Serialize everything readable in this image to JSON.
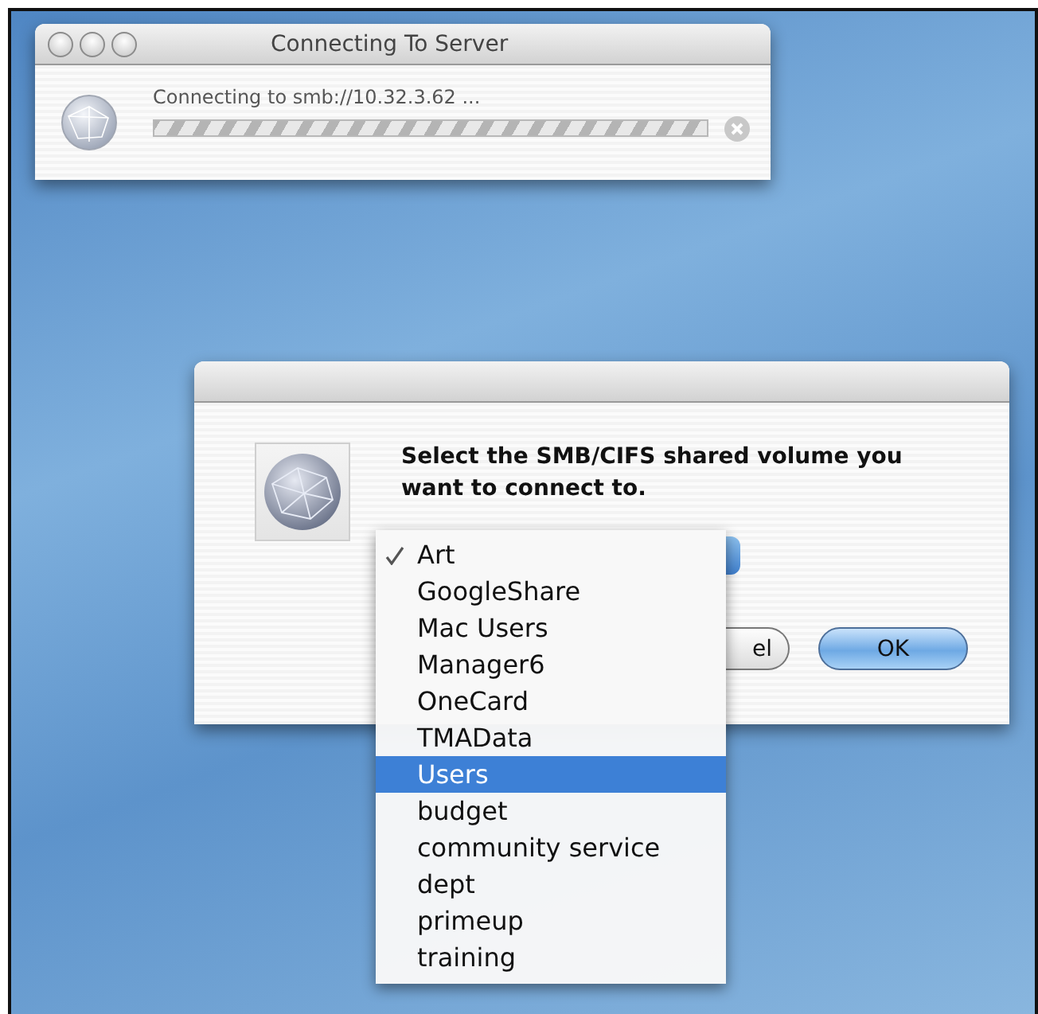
{
  "progress_window": {
    "title": "Connecting To Server",
    "message": "Connecting to smb://10.32.3.62 ...",
    "indeterminate": true
  },
  "dialog": {
    "prompt": "Select the SMB/CIFS shared volume you want to connect to.",
    "buttons": [
      {
        "label": "el",
        "kind": "cancel",
        "default": false
      },
      {
        "label": "OK",
        "kind": "ok",
        "default": true
      }
    ]
  },
  "menu": {
    "items": [
      {
        "label": "Art",
        "checked": true,
        "selected": false
      },
      {
        "label": "GoogleShare",
        "checked": false,
        "selected": false
      },
      {
        "label": "Mac Users",
        "checked": false,
        "selected": false
      },
      {
        "label": "Manager6",
        "checked": false,
        "selected": false
      },
      {
        "label": "OneCard",
        "checked": false,
        "selected": false
      },
      {
        "label": "TMAData",
        "checked": false,
        "selected": false
      },
      {
        "label": "Users",
        "checked": false,
        "selected": true
      },
      {
        "label": "budget",
        "checked": false,
        "selected": false
      },
      {
        "label": "community service",
        "checked": false,
        "selected": false
      },
      {
        "label": "dept",
        "checked": false,
        "selected": false
      },
      {
        "label": "primeup",
        "checked": false,
        "selected": false
      },
      {
        "label": "training",
        "checked": false,
        "selected": false
      }
    ]
  }
}
